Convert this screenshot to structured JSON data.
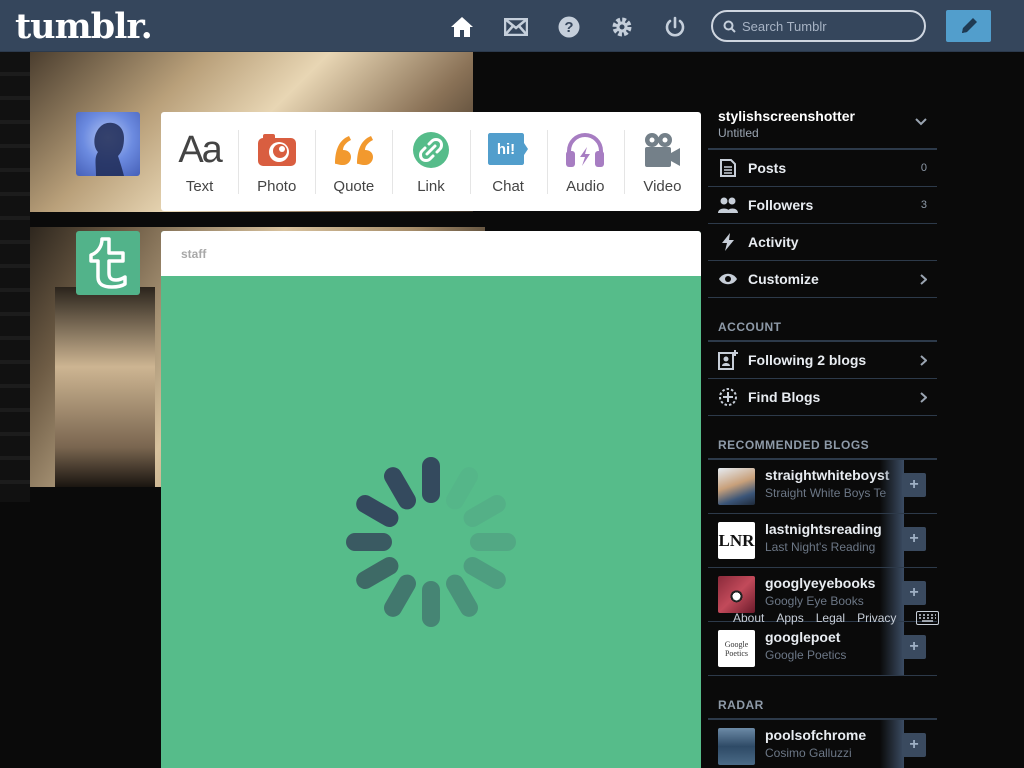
{
  "header": {
    "logo": "tumblr.",
    "search_placeholder": "Search Tumblr",
    "nav": [
      "home-icon",
      "mail-icon",
      "help-icon",
      "gear-icon",
      "power-icon"
    ]
  },
  "post_types": [
    {
      "label": "Text",
      "icon": "text-icon",
      "color": "#444444"
    },
    {
      "label": "Photo",
      "icon": "camera-icon",
      "color": "#d95e40"
    },
    {
      "label": "Quote",
      "icon": "quote-icon",
      "color": "#f2992e"
    },
    {
      "label": "Link",
      "icon": "link-icon",
      "color": "#56bc8a"
    },
    {
      "label": "Chat",
      "icon": "chat-icon",
      "color": "#529ecc"
    },
    {
      "label": "Audio",
      "icon": "headphones-icon",
      "color": "#a77dc2"
    },
    {
      "label": "Video",
      "icon": "video-camera-icon",
      "color": "#748089"
    }
  ],
  "post": {
    "author": "staff"
  },
  "sidebar": {
    "blog_name": "stylishscreenshotter",
    "blog_title": "Untitled",
    "items": [
      {
        "label": "Posts",
        "count": "0",
        "icon": "posts-icon"
      },
      {
        "label": "Followers",
        "count": "3",
        "icon": "followers-icon"
      },
      {
        "label": "Activity",
        "count": "",
        "icon": "activity-icon"
      },
      {
        "label": "Customize",
        "count": "",
        "icon": "eye-icon"
      }
    ],
    "account_heading": "ACCOUNT",
    "account_items": [
      {
        "label": "Following 2 blogs",
        "icon": "following-icon"
      },
      {
        "label": "Find Blogs",
        "icon": "find-blogs-icon"
      }
    ],
    "recommended_heading": "RECOMMENDED BLOGS",
    "recommended": [
      {
        "name": "straightwhiteboyst",
        "title": "Straight White Boys Te"
      },
      {
        "name": "lastnightsreading",
        "title": "Last Night's Reading"
      },
      {
        "name": "googlyeyebooks",
        "title": "Googly Eye Books"
      },
      {
        "name": "googlepoet",
        "title": "Google Poetics"
      }
    ],
    "radar_heading": "RADAR",
    "radar": [
      {
        "name": "poolsofchrome",
        "title": "Cosimo Galluzzi"
      }
    ]
  },
  "footer": [
    "About",
    "Apps",
    "Legal",
    "Privacy"
  ]
}
